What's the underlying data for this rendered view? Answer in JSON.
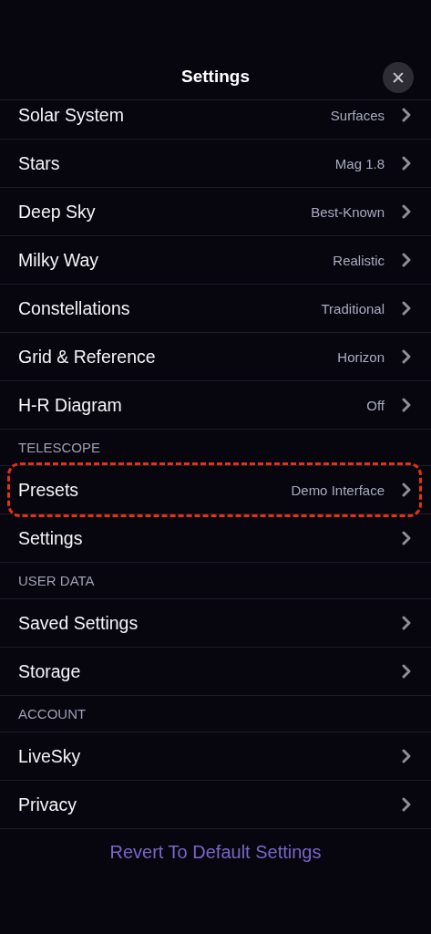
{
  "title": "Settings",
  "close_label": "✕",
  "sections": [
    {
      "rows": [
        {
          "label": "Solar System",
          "value": "Surfaces",
          "highlighted": false
        },
        {
          "label": "Stars",
          "value": "Mag 1.8",
          "highlighted": false
        },
        {
          "label": "Deep Sky",
          "value": "Best-Known",
          "highlighted": false
        },
        {
          "label": "Milky Way",
          "value": "Realistic",
          "highlighted": false
        },
        {
          "label": "Constellations",
          "value": "Traditional",
          "highlighted": false
        },
        {
          "label": "Grid & Reference",
          "value": "Horizon",
          "highlighted": false
        },
        {
          "label": "H-R Diagram",
          "value": "Off",
          "highlighted": false
        }
      ]
    },
    {
      "header": "TELESCOPE",
      "rows": [
        {
          "label": "Presets",
          "value": "Demo Interface",
          "highlighted": true
        },
        {
          "label": "Settings",
          "highlighted": false
        }
      ]
    },
    {
      "header": "USER DATA",
      "rows": [
        {
          "label": "Saved Settings",
          "highlighted": false
        },
        {
          "label": "Storage",
          "highlighted": false
        }
      ]
    },
    {
      "header": "ACCOUNT",
      "rows": [
        {
          "label": "LiveSky",
          "highlighted": false
        },
        {
          "label": "Privacy",
          "highlighted": false
        }
      ]
    }
  ],
  "footer_button": "Revert To Default Settings"
}
